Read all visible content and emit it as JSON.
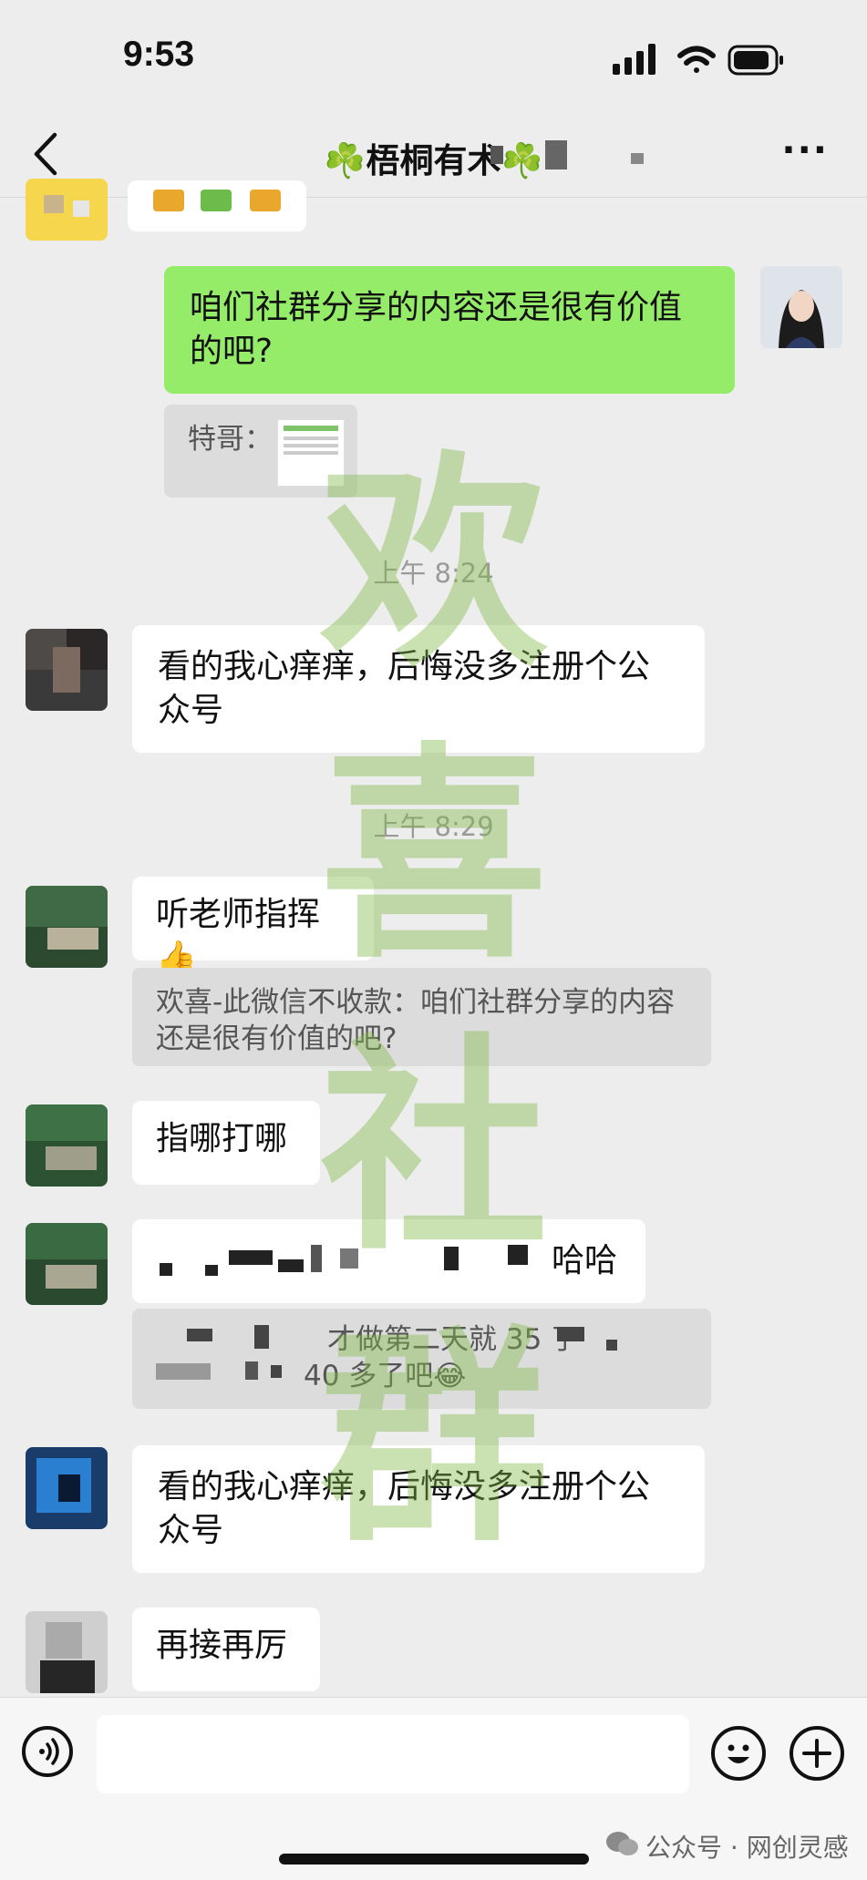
{
  "status_bar": {
    "time": "9:53"
  },
  "header": {
    "title": "☘️梧桐有术☘️",
    "more": "···"
  },
  "messages": {
    "m1": "咱们社群分享的内容还是很有价值的吧?",
    "m1_quote": "特哥：",
    "t1": "上午 8:24",
    "m2": "看的我心痒痒，后悔没多注册个公众号",
    "t2": "上午 8:29",
    "m3": "听老师指挥👍",
    "m3_quote": "欢喜-此微信不收款：咱们社群分享的内容还是很有价值的吧?",
    "m4": "指哪打哪",
    "m5": "哈哈",
    "m5_quote_a": "才做第二天就 35 了",
    "m5_quote_b": "40 多了吧😂",
    "m6": "看的我心痒痒，后悔没多注册个公众号",
    "m7": "再接再厉"
  },
  "watermark": {
    "c1": "欢",
    "c2": "喜",
    "c3": "社",
    "c4": "群"
  },
  "footer": {
    "source": "公众号 · 网创灵感"
  }
}
